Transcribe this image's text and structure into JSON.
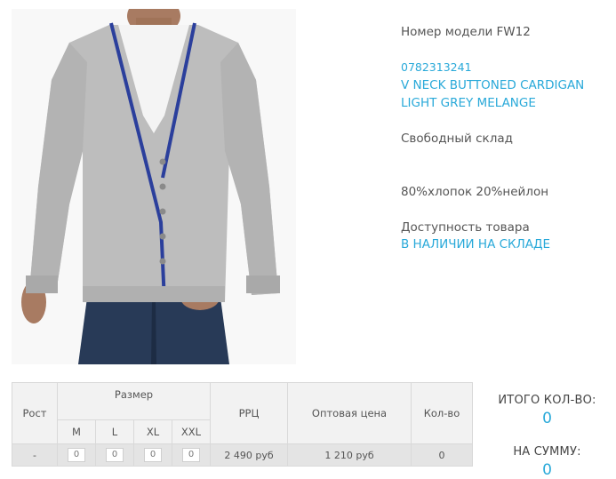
{
  "product": {
    "model_label": "Номер модели FW12",
    "sku": "0782313241",
    "name_line1": "V NECK BUTTONED CARDIGAN",
    "name_line2": "LIGHT GREY MELANGE",
    "stock_type": "Свободный склад",
    "composition": "80%хлопок 20%нейлон",
    "availability_label": "Доступность товара",
    "availability_value": "В НАЛИЧИИ НА СКЛАДЕ",
    "photo_icon": "product-photo-cardigan"
  },
  "table": {
    "col_height": "Рост",
    "col_size": "Размер",
    "col_rrp": "РРЦ",
    "col_wholesale": "Оптовая цена",
    "col_qty": "Кол-во",
    "sizes": [
      "M",
      "L",
      "XL",
      "XXL"
    ],
    "row": {
      "height": "-",
      "qty_inputs": [
        "0",
        "0",
        "0",
        "0"
      ],
      "rrp": "2 490 руб",
      "wholesale": "1 210 руб",
      "qty": "0"
    }
  },
  "totals": {
    "total_qty_label": "ИТОГО КОЛ-ВО:",
    "total_qty_value": "0",
    "total_sum_label": "НА СУММУ:",
    "total_sum_value": "0"
  },
  "colors": {
    "accent": "#29a9d9",
    "text": "#555555",
    "table_bg": "#f2f2f2"
  }
}
